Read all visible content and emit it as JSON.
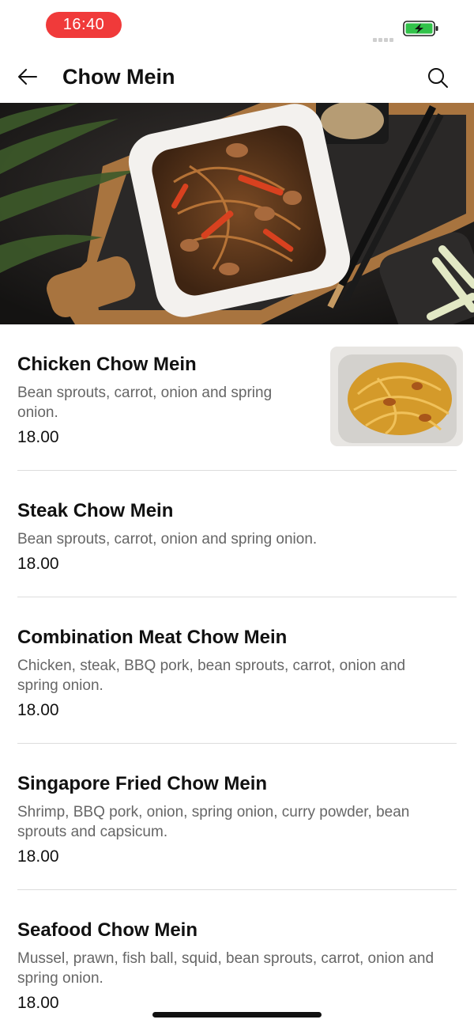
{
  "status_bar": {
    "time": "16:40",
    "battery_state": "charging",
    "icons": [
      "signal-icon",
      "battery-charging-icon"
    ]
  },
  "header": {
    "title": "Chow Mein",
    "back_icon": "arrow-left-icon",
    "search_icon": "search-icon"
  },
  "colors": {
    "time_pill": "#f03a3a",
    "battery_green": "#32c24a",
    "text_primary": "#111111",
    "text_secondary": "#666666",
    "divider": "#dcdcdc"
  },
  "menu": {
    "items": [
      {
        "name": "Chicken Chow Mein",
        "desc_line1": "Bean sprouts, carrot, onion and spring",
        "desc_line2": "onion.",
        "price": "18.00"
      },
      {
        "name": "Steak Chow Mein",
        "desc_line1": "Bean sprouts, carrot, onion and spring onion.",
        "desc_line2": "",
        "price": "18.00"
      },
      {
        "name": "Combination Meat Chow Mein",
        "desc_line1": "Chicken, steak, BBQ pork, bean sprouts, carrot, onion and",
        "desc_line2": "spring onion.",
        "price": "18.00"
      },
      {
        "name": "Singapore Fried Chow Mein",
        "desc_line1": "Shrimp, BBQ pork, onion, spring onion, curry powder, bean",
        "desc_line2": "sprouts and capsicum.",
        "price": "18.00"
      },
      {
        "name": "Seafood Chow Mein",
        "desc_line1": "Mussel, prawn, fish ball, squid, bean sprouts, carrot, onion and",
        "desc_line2": "spring onion.",
        "price": "18.00"
      }
    ]
  }
}
